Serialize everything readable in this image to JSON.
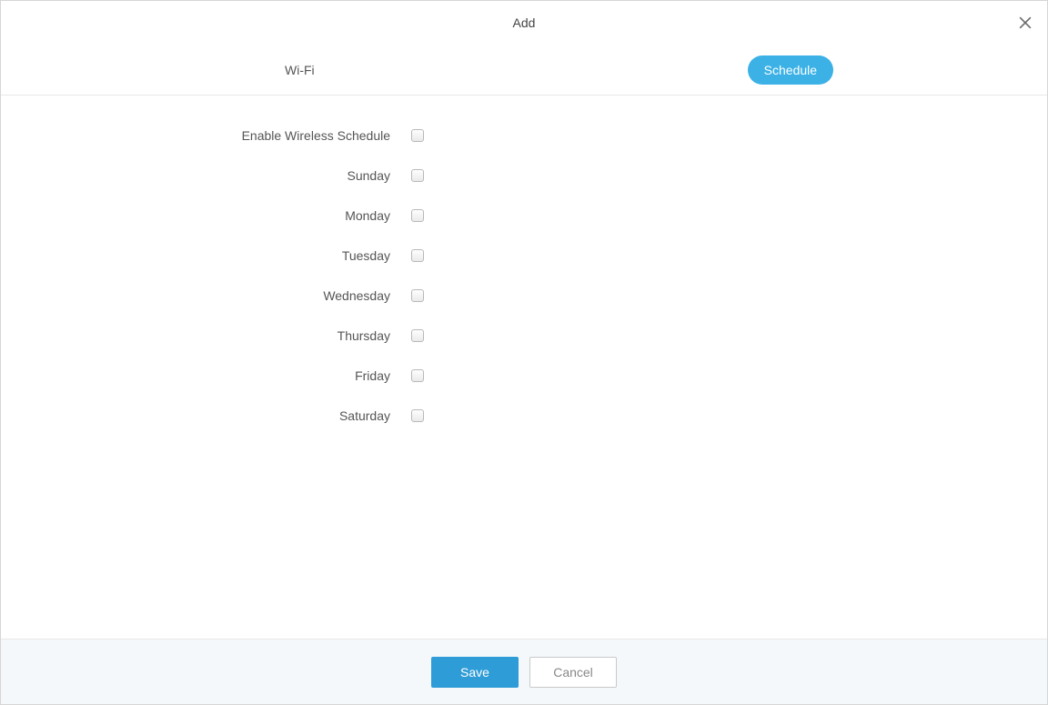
{
  "header": {
    "title": "Add"
  },
  "tabs": {
    "wifi": "Wi-Fi",
    "schedule": "Schedule"
  },
  "form": {
    "enable_label": "Enable Wireless Schedule",
    "days": {
      "sunday": "Sunday",
      "monday": "Monday",
      "tuesday": "Tuesday",
      "wednesday": "Wednesday",
      "thursday": "Thursday",
      "friday": "Friday",
      "saturday": "Saturday"
    }
  },
  "footer": {
    "save": "Save",
    "cancel": "Cancel"
  }
}
